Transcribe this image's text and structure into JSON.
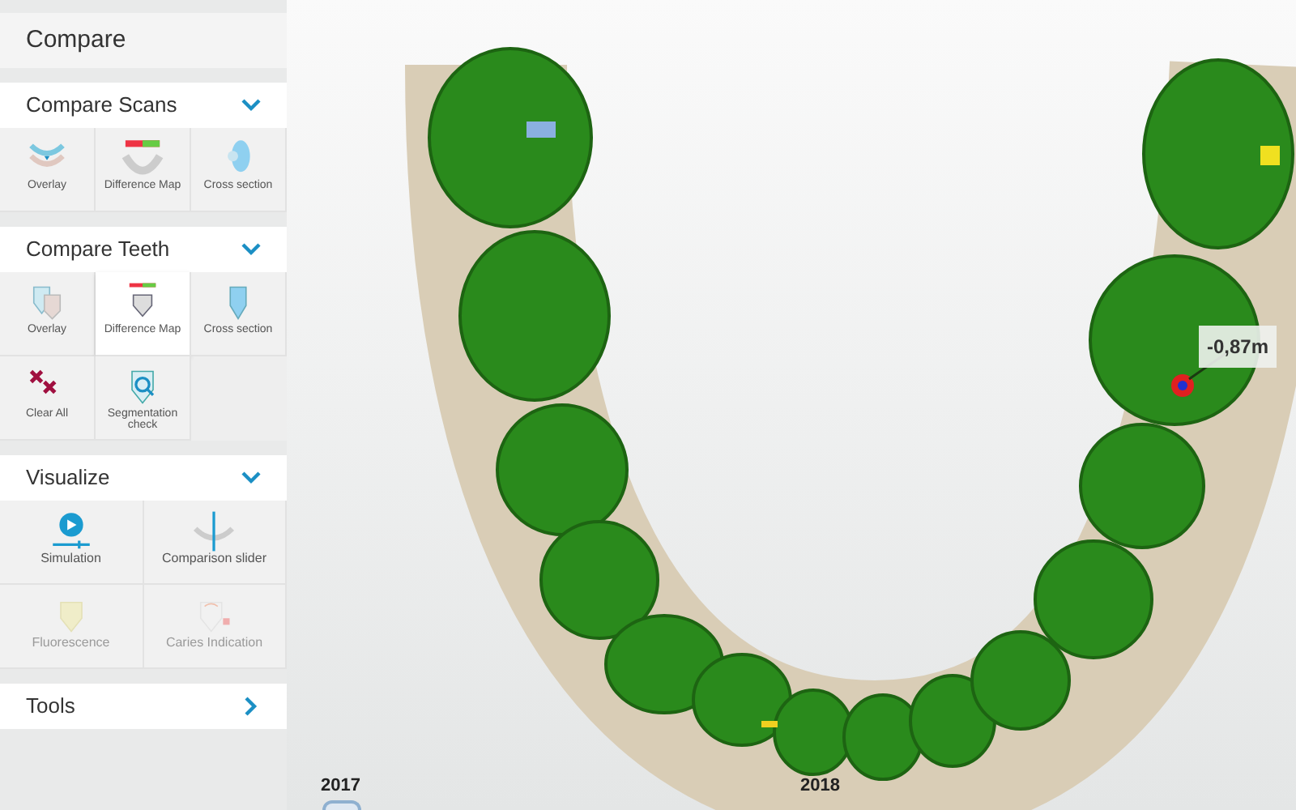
{
  "panel": {
    "title": "Compare",
    "sections": [
      {
        "title": "Compare Scans",
        "expanded": true,
        "tools": [
          {
            "kind": "arch-overlay",
            "label": "Overlay",
            "selected": false,
            "disabled": false
          },
          {
            "kind": "arch-difference",
            "label": "Difference Map",
            "selected": false,
            "disabled": false
          },
          {
            "kind": "cross-section",
            "label": "Cross section",
            "selected": false,
            "disabled": false
          }
        ]
      },
      {
        "title": "Compare Teeth",
        "expanded": true,
        "tools": [
          {
            "kind": "tooth-overlay",
            "label": "Overlay",
            "selected": false,
            "disabled": false
          },
          {
            "kind": "tooth-difference",
            "label": "Difference Map",
            "selected": true,
            "disabled": false
          },
          {
            "kind": "tooth-section",
            "label": "Cross section",
            "selected": false,
            "disabled": false
          },
          {
            "kind": "clear",
            "label": "Clear All",
            "selected": false,
            "disabled": false
          },
          {
            "kind": "segmentation",
            "label": "Segmentation check",
            "selected": false,
            "disabled": false
          }
        ]
      },
      {
        "title": "Visualize",
        "expanded": true,
        "tools": [
          {
            "kind": "simulation",
            "label": "Simulation",
            "selected": false,
            "disabled": false
          },
          {
            "kind": "slider",
            "label": "Comparison slider",
            "selected": false,
            "disabled": false
          },
          {
            "kind": "fluorescence",
            "label": "Fluorescence",
            "selected": false,
            "disabled": true
          },
          {
            "kind": "caries",
            "label": "Caries Indication",
            "selected": false,
            "disabled": true
          }
        ]
      },
      {
        "title": "Tools",
        "expanded": false
      }
    ]
  },
  "viewer": {
    "measurement": "-0,87m",
    "timeline": {
      "labels": [
        "2017",
        "2018"
      ]
    }
  }
}
